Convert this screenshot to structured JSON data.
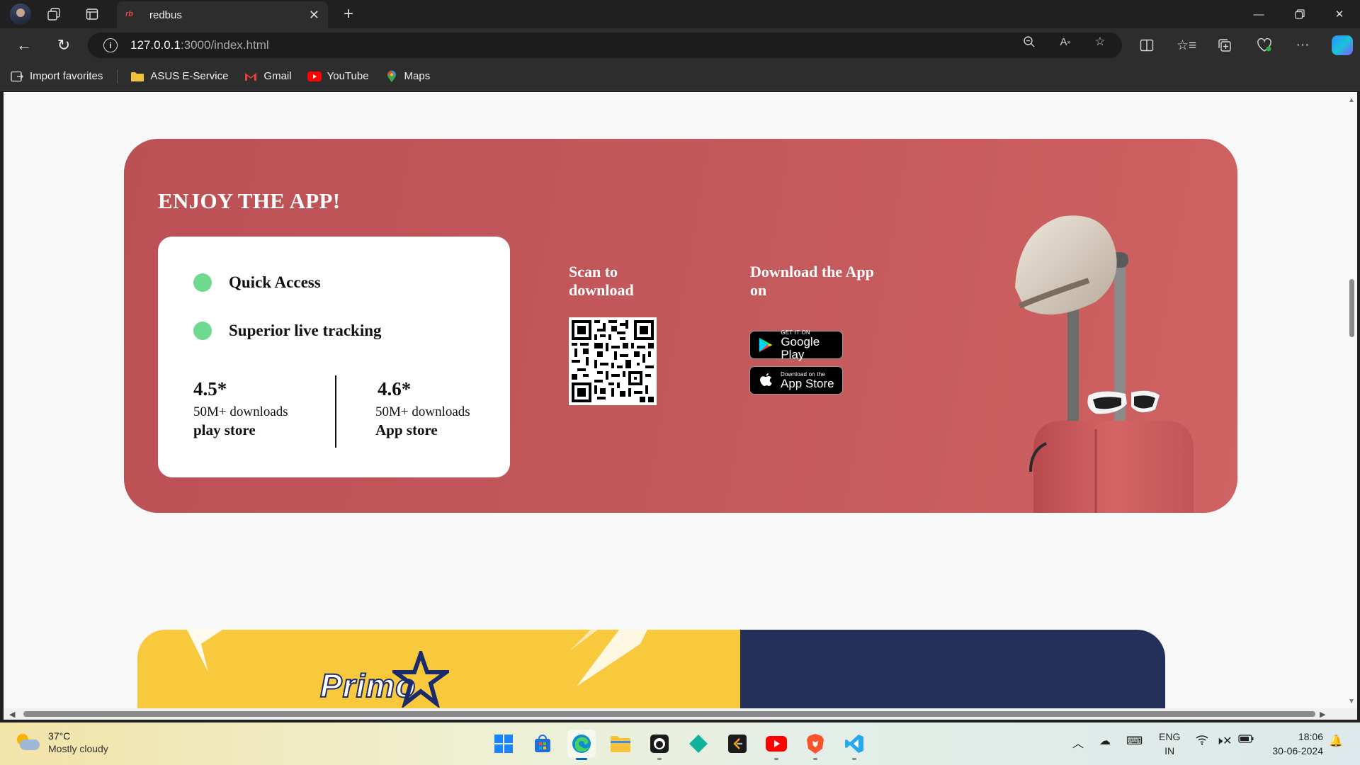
{
  "browser": {
    "tab_title": "redbus",
    "tab_favicon_text": "rb",
    "url_host": "127.0.0.1",
    "url_rest": ":3000/index.html",
    "favorites": [
      {
        "label": "Import favorites",
        "icon": "import-icon"
      },
      {
        "label": "ASUS E-Service",
        "icon": "folder-icon"
      },
      {
        "label": "Gmail",
        "icon": "gmail-icon"
      },
      {
        "label": "YouTube",
        "icon": "youtube-icon"
      },
      {
        "label": "Maps",
        "icon": "maps-icon"
      }
    ]
  },
  "app_section": {
    "heading": "ENJOY THE APP!",
    "features": [
      "Quick Access",
      "Superior live tracking"
    ],
    "ratings": [
      {
        "score": "4.5*",
        "downloads": "50M+ downloads",
        "store": "play store"
      },
      {
        "score": "4.6*",
        "downloads": "50M+ downloads",
        "store": "App store"
      }
    ],
    "scan_title": "Scan to download",
    "download_title": "Download the App on",
    "badges": [
      {
        "small": "GET IT ON",
        "big": "Google Play"
      },
      {
        "small": "Download on the",
        "big": "App Store"
      }
    ],
    "colors": {
      "banner": "#c55a5d",
      "bullet": "#6fd98f"
    }
  },
  "next_section": {
    "logo_text": "Primo",
    "colors": {
      "left": "#f9c93d",
      "right": "#22305a"
    }
  },
  "taskbar": {
    "weather_temp": "37°C",
    "weather_desc": "Mostly cloudy",
    "lang_top": "ENG",
    "lang_bottom": "IN",
    "time": "18:06",
    "date": "30-06-2024"
  }
}
